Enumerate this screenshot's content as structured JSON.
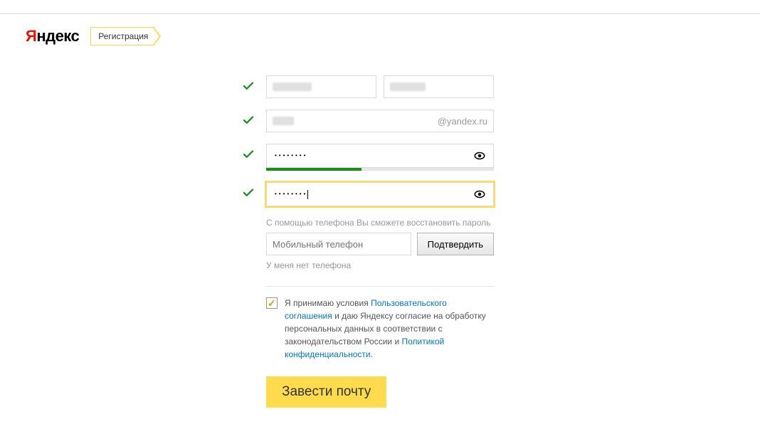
{
  "logo": {
    "red": "Я",
    "rest": "ндекс"
  },
  "header": {
    "registration": "Регистрация"
  },
  "form": {
    "login_suffix": "@yandex.ru",
    "password_dots": "••••••••",
    "confirm_dots": "••••••••",
    "password_strength_pct": 42,
    "phone_hint": "С помощью телефона Вы сможете восстановить пароль",
    "phone_placeholder": "Мобильный телефон",
    "confirm_btn": "Подтвердить",
    "no_phone": "У меня нет телефона"
  },
  "terms": {
    "prefix": "Я принимаю условия ",
    "link1": "Пользовательского соглашения",
    "middle": " и даю Яндексу согласие на обработку персональных данных в соответствии с законодательством России и ",
    "link2": "Политикой конфиденциальности",
    "suffix": "."
  },
  "submit": "Завести почту"
}
